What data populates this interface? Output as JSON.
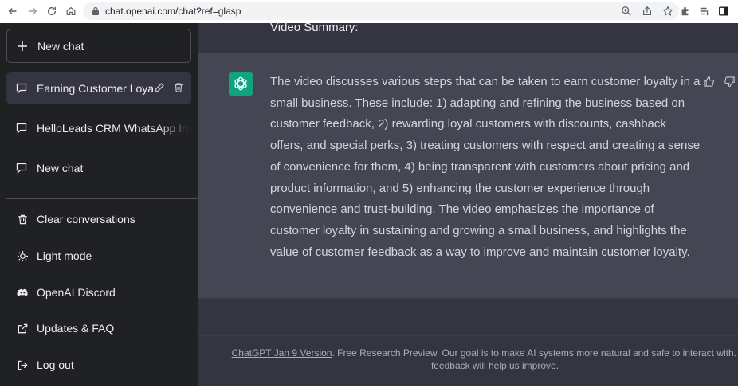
{
  "browser": {
    "url": "chat.openai.com/chat?ref=glasp"
  },
  "sidebar": {
    "new_chat_label": "New chat",
    "chats": [
      {
        "title": "Earning Customer Loyal",
        "active": true
      },
      {
        "title": "HelloLeads CRM WhatsApp Im",
        "active": false
      },
      {
        "title": "New chat",
        "active": false
      }
    ],
    "menu": [
      {
        "label": "Clear conversations",
        "icon": "trash-icon"
      },
      {
        "label": "Light mode",
        "icon": "sun-icon"
      },
      {
        "label": "OpenAI Discord",
        "icon": "discord-icon"
      },
      {
        "label": "Updates & FAQ",
        "icon": "external-link-icon"
      },
      {
        "label": "Log out",
        "icon": "logout-icon"
      }
    ]
  },
  "conversation": {
    "user_message": "Video Summary:",
    "assistant_message": "The video discusses various steps that can be taken to earn customer loyalty in a small business. These include: 1) adapting and refining the business based on customer feedback, 2) rewarding loyal customers with discounts, cashback offers, and special perks, 3) treating customers with respect and creating a sense of convenience for them, 4) being transparent with customers about pricing and product information, and 5) enhancing the customer experience through convenience and trust-building. The video emphasizes the importance of customer loyalty in sustaining and growing a small business, and highlights the value of customer feedback as a way to improve and maintain customer loyalty."
  },
  "footer": {
    "version_link": "ChatGPT Jan 9 Version",
    "text": ". Free Research Preview. Our goal is to make AI systems more natural and safe to interact with. Your feedback will help us improve."
  },
  "colors": {
    "sidebar_bg": "#202123",
    "main_bg": "#343541",
    "assistant_bg": "#444654",
    "avatar_green": "#10a37f"
  }
}
